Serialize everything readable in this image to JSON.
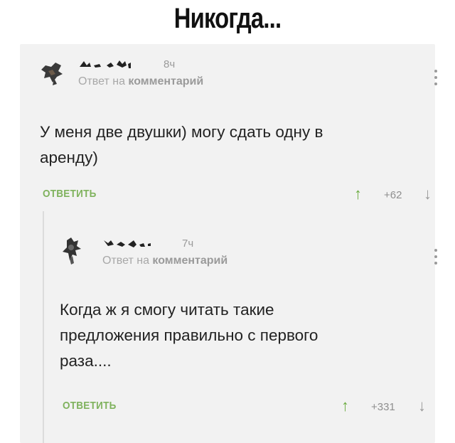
{
  "header": {
    "title": "Никогда..."
  },
  "comments": [
    {
      "time": "8ч",
      "reply_to_prefix": "Ответ на ",
      "reply_to_bold": "комментарий",
      "body_lines": [
        "У меня две двушки) могу сдать одну в",
        "аренду)"
      ],
      "reply_label": "ОТВЕТИТЬ",
      "rating": "+62",
      "up_icon": "↑",
      "down_icon": "↓"
    },
    {
      "time": "7ч",
      "reply_to_prefix": "Ответ на ",
      "reply_to_bold": "комментарий",
      "body_lines": [
        "Когда ж я смогу читать такие",
        "предложения правильно с первого",
        "раза...."
      ],
      "reply_label": "ОТВЕТИТЬ",
      "rating": "+331",
      "up_icon": "↑",
      "down_icon": "↓"
    }
  ],
  "colors": {
    "accent_green": "#7fb25d",
    "upvote_green": "#6aab3f",
    "muted_text": "#9a9a9a",
    "card_bg": "#f2f2f2"
  }
}
